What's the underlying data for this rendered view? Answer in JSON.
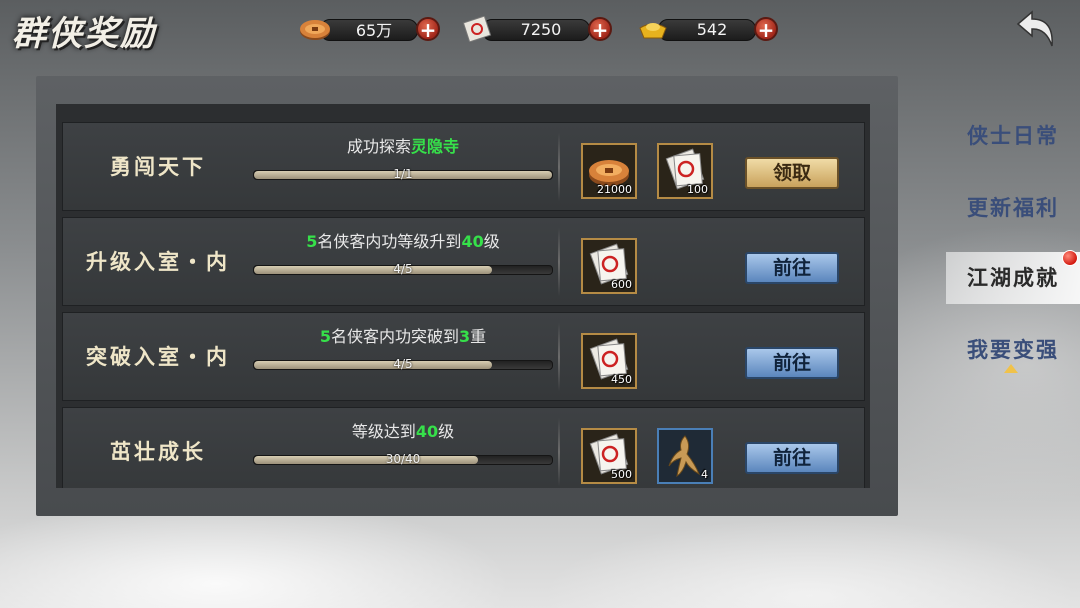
{
  "header": {
    "title": "群侠奖励",
    "resources": [
      {
        "icon": "copper-coin-icon",
        "value": "65万"
      },
      {
        "icon": "ticket-scroll-icon",
        "value": "7250"
      },
      {
        "icon": "gold-ingot-icon",
        "value": "542"
      }
    ],
    "back_icon": "back-arrow-icon"
  },
  "tasks": [
    {
      "name": "勇闯天下",
      "desc_parts": [
        "成功探索",
        "灵隐寺",
        ""
      ],
      "progress_text": "1/1",
      "progress": 1.0,
      "rewards": [
        {
          "icon": "copper-coin-icon",
          "qty": "21000",
          "frame": "gold"
        },
        {
          "icon": "ticket-scroll-icon",
          "qty": "100",
          "frame": "gold"
        }
      ],
      "button": "领取",
      "button_type": "claim"
    },
    {
      "name": "升级入室・内",
      "desc_parts": [
        "",
        "5",
        "名侠客内功等级升到",
        "40",
        "级"
      ],
      "progress_text": "4/5",
      "progress": 0.8,
      "rewards": [
        {
          "icon": "ticket-scroll-icon",
          "qty": "600",
          "frame": "gold"
        }
      ],
      "button": "前往",
      "button_type": "go"
    },
    {
      "name": "突破入室・内",
      "desc_parts": [
        "",
        "5",
        "名侠客内功突破到",
        "3",
        "重"
      ],
      "progress_text": "4/5",
      "progress": 0.8,
      "rewards": [
        {
          "icon": "ticket-scroll-icon",
          "qty": "450",
          "frame": "gold"
        }
      ],
      "button": "前往",
      "button_type": "go"
    },
    {
      "name": "茁壮成长",
      "desc_parts": [
        "等级达到",
        "40",
        "级"
      ],
      "progress_text": "30/40",
      "progress": 0.75,
      "rewards": [
        {
          "icon": "ticket-scroll-icon",
          "qty": "500",
          "frame": "gold"
        },
        {
          "icon": "ginseng-root-icon",
          "qty": "4",
          "frame": "blue"
        }
      ],
      "button": "前往",
      "button_type": "go"
    }
  ],
  "sidebar": {
    "tabs": [
      {
        "label": "侠士日常",
        "active": false
      },
      {
        "label": "更新福利",
        "active": false
      },
      {
        "label": "江湖成就",
        "active": true,
        "badge": "red-dot"
      },
      {
        "label": "我要变强",
        "active": false,
        "indicator": "up-arrow"
      }
    ]
  },
  "colors": {
    "highlight_green": "#36e04a",
    "claim_button": "#e0c98a",
    "go_button": "#8aaed8",
    "sidebar_text": "#3a4e7a"
  }
}
